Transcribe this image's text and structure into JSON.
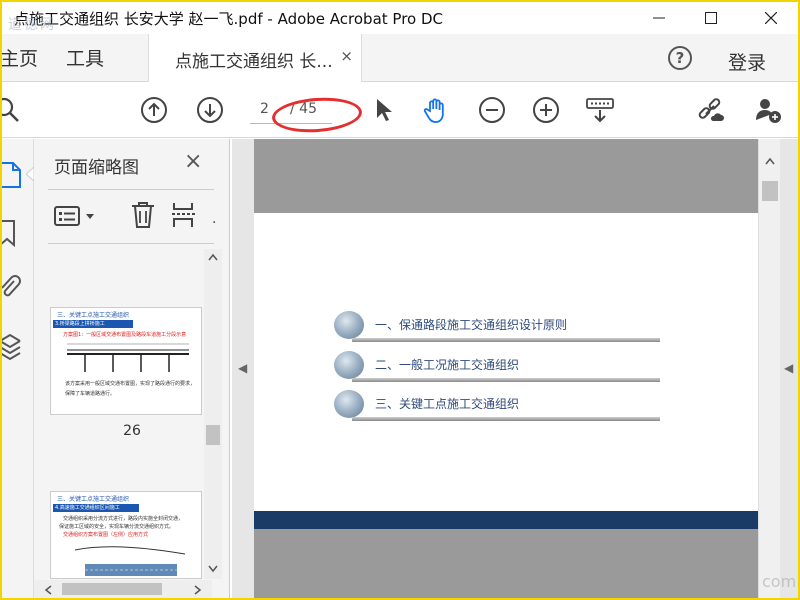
{
  "window": {
    "title": "点施工交通组织 长安大学 赵一飞.pdf - Adobe Acrobat Pro DC",
    "watermark": "道德网",
    "watermark_bottom": "com"
  },
  "menu": {
    "home": "主页",
    "tools": "工具",
    "tab_label": "点施工交通组织 长...",
    "tab_close": "×",
    "help": "?",
    "login": "登录"
  },
  "toolbar": {
    "current_page": "2",
    "total_pages": "/ 45"
  },
  "panel": {
    "title": "页面缩略图",
    "close": "×",
    "thumbnails": [
      {
        "page_number": "26",
        "heading": "三、关键工点施工交通组织",
        "bar": "3.桥梁路段上拼桥施工",
        "red": "方案图1：一般区域交通布置图及路段车道施工分段示意",
        "text1": "该方案采用一般区域交通布置图，实现了路段通行的要求，",
        "text2": "保障了车辆道路通行。"
      },
      {
        "page_number": "",
        "heading": "三、关键工点施工交通组织",
        "bar": "4.高速施工交通组织区间施工",
        "text1": "交通组织采用分流方式进行，路段内实施全封闭交通，",
        "text2": "保证施工区域的安全，实现车辆分流交通组织方式。",
        "red": "交通组织方案布置图（左侧）应用方式"
      }
    ]
  },
  "document": {
    "toc": [
      "一、保通路段施工交通组织设计原则",
      "二、一般工况施工交通组织",
      "三、关键工点施工交通组织"
    ]
  },
  "colors": {
    "accent": "#1473e6",
    "annotation_red": "#e3302f",
    "slide_footer": "#1a3b66"
  }
}
